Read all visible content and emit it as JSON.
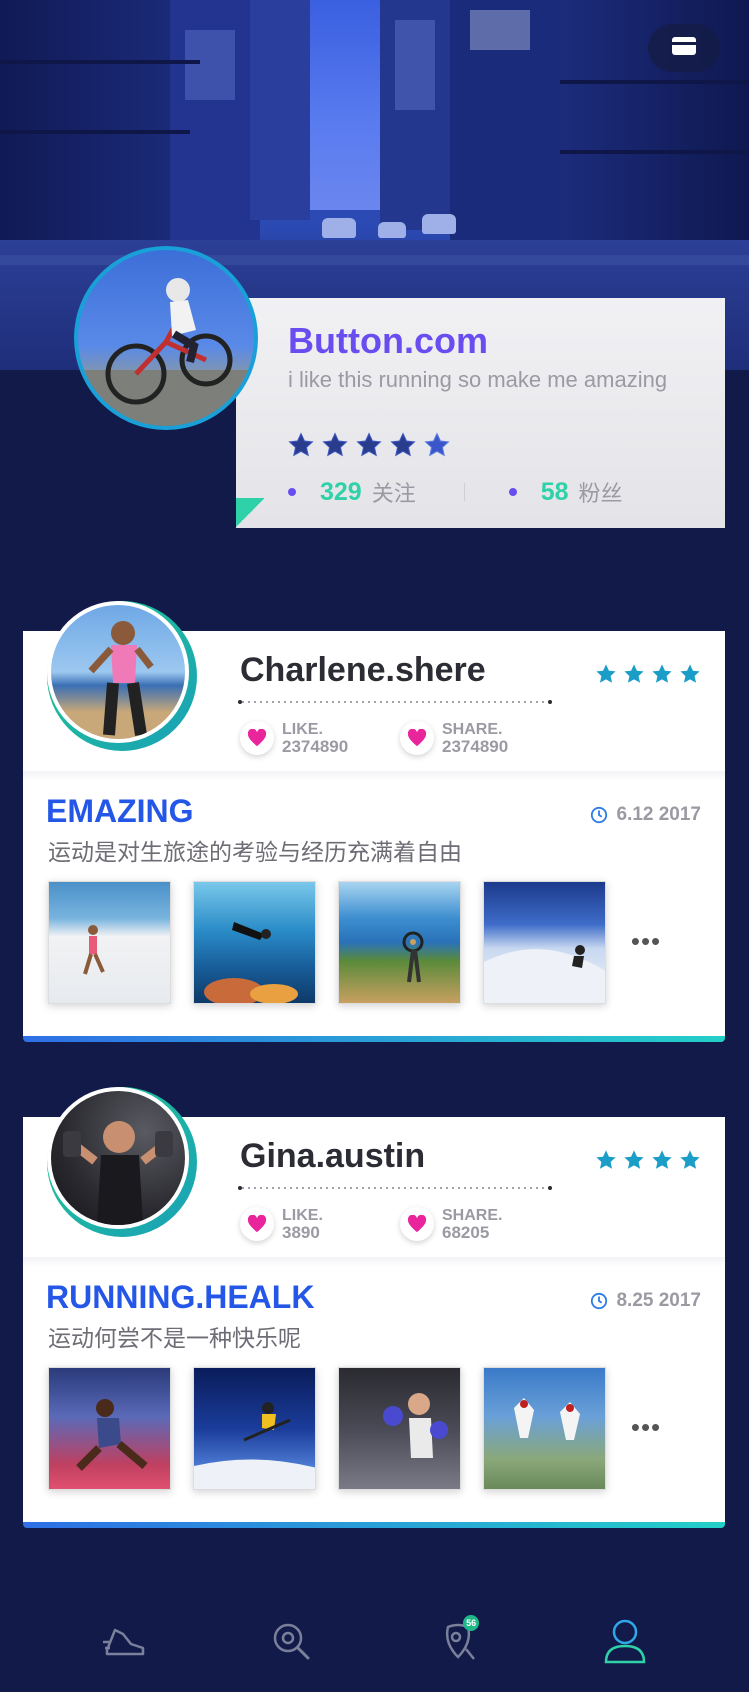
{
  "hero": {
    "wallet_icon": "wallet-card-icon"
  },
  "profile": {
    "name": "Button.com",
    "bio": "i like this running so make me amazing",
    "rating_stars": 5,
    "following_count": "329",
    "following_label": "关注",
    "followers_count": "58",
    "followers_label": "粉丝"
  },
  "posts": [
    {
      "user": "Charlene.shere",
      "stars": 4,
      "like_label": "LIKE.",
      "like_count": "2374890",
      "share_label": "SHARE.",
      "share_count": "2374890",
      "title": "EMAZING",
      "date": "6.12  2017",
      "description": "运动是对生旅途的考验与经历充满着自由",
      "thumbnails": [
        "runner-beach",
        "scuba-diver",
        "mountain-biker-coast",
        "snowboarder"
      ],
      "more": "•••"
    },
    {
      "user": "Gina.austin",
      "stars": 4,
      "like_label": "LIKE.",
      "like_count": "3890",
      "share_label": "SHARE.",
      "share_count": "68205",
      "title": "RUNNING.HEALK",
      "date": "8.25  2017",
      "description": "运动何尝不是一种快乐呢",
      "thumbnails": [
        "sprinter",
        "skier-jump",
        "boxer",
        "skydivers"
      ],
      "more": "•••"
    }
  ],
  "nav": {
    "items": [
      "shoe-icon",
      "search-icon",
      "notification-icon",
      "profile-icon"
    ],
    "badge": "56",
    "active": "profile-icon"
  },
  "colors": {
    "background": "#121a4a",
    "accent_purple": "#6a4df0",
    "accent_green": "#2fd2a8",
    "title_blue": "#2457e8",
    "star_teal": "#1a9ec8",
    "heart_pink": "#e8259a"
  }
}
